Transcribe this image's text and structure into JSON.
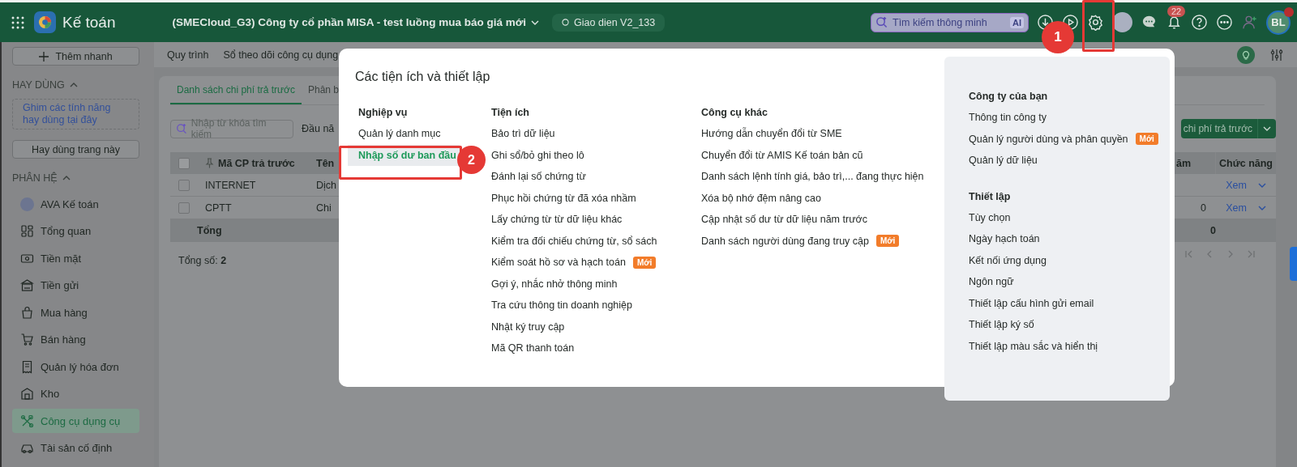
{
  "header": {
    "app_name": "Kế toán",
    "company": "(SMECloud_G3) Công ty cổ phần MISA - test luồng mua báo giá mới",
    "environment": "Giao dien V2_133",
    "search": {
      "placeholder": "Tìm kiếm thông minh",
      "ai_label": "AI"
    },
    "notification_count": "22",
    "user_initials": "BL"
  },
  "sidebar": {
    "quick_add": "Thêm nhanh",
    "favorites": {
      "title": "HAY DÙNG",
      "expanded": true,
      "hint": "Ghim các tính năng hay dùng tại đây",
      "pin_button": "Hay dùng trang này"
    },
    "modules": {
      "title": "PHÂN HỆ",
      "expanded": true,
      "items": [
        {
          "kind": "avatar",
          "label": "AVA Kế toán",
          "selected": false
        },
        {
          "kind": "module",
          "label": "Tổng quan",
          "selected": false
        },
        {
          "kind": "module",
          "label": "Tiền mặt",
          "selected": false
        },
        {
          "kind": "module",
          "label": "Tiền gửi",
          "selected": false
        },
        {
          "kind": "module",
          "label": "Mua hàng",
          "selected": false
        },
        {
          "kind": "module",
          "label": "Bán hàng",
          "selected": false
        },
        {
          "kind": "module",
          "label": "Quản lý hóa đơn",
          "selected": false
        },
        {
          "kind": "module",
          "label": "Kho",
          "selected": false
        },
        {
          "kind": "module",
          "label": "Công cụ dụng cụ",
          "selected": true
        },
        {
          "kind": "module",
          "label": "Tài sản cố định",
          "selected": false
        }
      ]
    }
  },
  "toolbar": {
    "links": [
      "Quy trình",
      "Sổ theo dõi công cụ dụng"
    ]
  },
  "content": {
    "tabs": [
      {
        "label": "Danh sách chi phí trả trước",
        "selected": true
      },
      {
        "label": "Phân b",
        "selected": false
      }
    ],
    "search": {
      "placeholder": "Nhập từ khóa tìm kiếm"
    },
    "period": "Đầu nă",
    "add_button": "chi phí trả trước",
    "table": {
      "select_all_checked": false,
      "columns": [
        {
          "label": "Mã CP trả trước"
        },
        {
          "label": "Tên"
        },
        {
          "label": "ăm"
        },
        {
          "label": "Chức năng"
        }
      ],
      "rows": [
        {
          "checked": false,
          "code": "INTERNET",
          "name": "Dịch",
          "action": "Xem"
        },
        {
          "checked": false,
          "code": "CPTT",
          "name": "Chi",
          "column_3": "0",
          "action": "Xem"
        }
      ],
      "total": {
        "label": "Tổng",
        "column_3": "0"
      }
    },
    "summary": "Tổng số: **2**"
  },
  "dialog": {
    "title": "Các tiện ích và thiết lập",
    "columns": [
      {
        "heading": "Nghiệp vụ",
        "items": [
          {
            "label": "Quản lý danh mục",
            "selected": false
          },
          {
            "label": "Nhập số dư ban đầu",
            "selected": true
          }
        ]
      },
      {
        "heading": "Tiện ích",
        "items": [
          {
            "label": "Bảo trì dữ liệu",
            "selected": false
          },
          {
            "label": "Ghi sổ/bỏ ghi theo lô",
            "selected": false
          },
          {
            "label": "Đánh lại số chứng từ",
            "selected": false
          },
          {
            "label": "Phục hồi chứng từ đã xóa nhầm",
            "selected": false
          },
          {
            "label": "Lấy chứng từ từ dữ liệu khác",
            "selected": false
          },
          {
            "label": "Kiểm tra đối chiếu chứng từ, sổ sách",
            "selected": false
          },
          {
            "label": "Kiểm soát hồ sơ và hạch toán",
            "selected": false,
            "badge": "Mới"
          },
          {
            "label": "Gợi ý, nhắc nhở thông minh",
            "selected": false
          },
          {
            "label": "Tra cứu thông tin doanh nghiệp",
            "selected": false
          },
          {
            "label": "Nhật ký truy cập",
            "selected": false
          },
          {
            "label": "Mã QR thanh toán",
            "selected": false
          }
        ]
      },
      {
        "heading": "Công cụ khác",
        "items": [
          {
            "label": "Hướng dẫn chuyển đổi từ SME",
            "selected": false
          },
          {
            "label": "Chuyển đổi từ AMIS Kế toán bản cũ",
            "selected": false
          },
          {
            "label": "Danh sách lệnh tính giá, bảo trì,... đang thực hiện",
            "selected": false
          },
          {
            "label": "Xóa bộ nhớ đệm nâng cao",
            "selected": false
          },
          {
            "label": "Cập nhật số dư từ dữ liệu năm trước",
            "selected": false
          },
          {
            "label": "Danh sách người dùng đang truy cập",
            "selected": false,
            "badge": "Mới"
          }
        ]
      }
    ],
    "panel": [
      {
        "heading": "Công ty của bạn",
        "items": [
          {
            "label": "Thông tin công ty",
            "selected": false
          },
          {
            "label": "Quản lý người dùng và phân quyền",
            "selected": false,
            "badge": "Mới"
          },
          {
            "label": "Quản lý dữ liệu",
            "selected": false
          }
        ]
      },
      {
        "heading": "Thiết lập",
        "items": [
          {
            "label": "Tùy chọn",
            "selected": false
          },
          {
            "label": "Ngày hạch toán",
            "selected": false
          },
          {
            "label": "Kết nối ứng dụng",
            "selected": false
          },
          {
            "label": "Ngôn ngữ",
            "selected": false
          },
          {
            "label": "Thiết lập cấu hình gửi email",
            "selected": false
          },
          {
            "label": "Thiết lập ký số",
            "selected": false
          },
          {
            "label": "Thiết lập màu sắc và hiển thị",
            "selected": false
          }
        ]
      }
    ]
  },
  "callouts": [
    {
      "number": "1"
    },
    {
      "number": "2"
    }
  ]
}
